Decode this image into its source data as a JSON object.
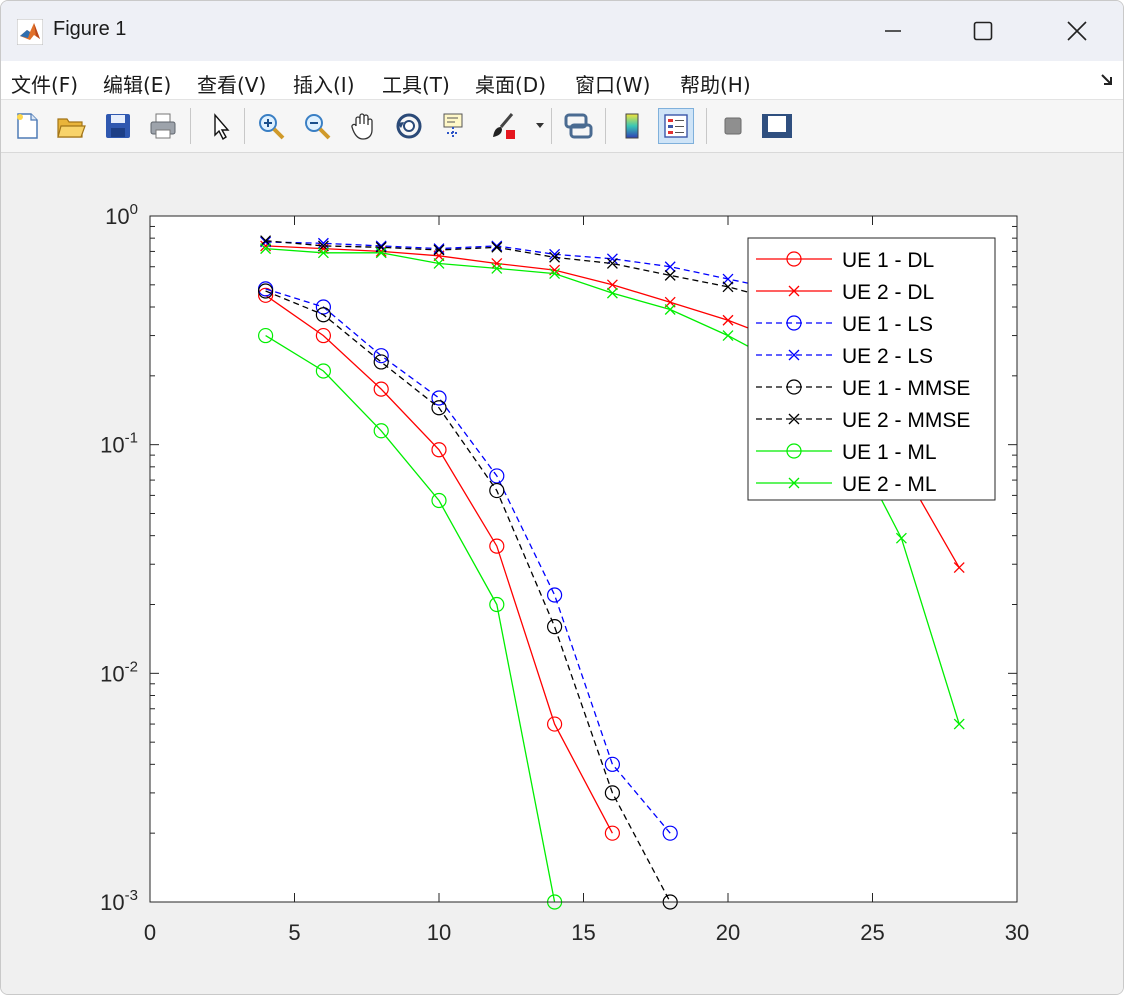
{
  "window": {
    "title": "Figure 1"
  },
  "menu": [
    {
      "label": "文件(F)",
      "key": "file"
    },
    {
      "label": "编辑(E)",
      "key": "edit"
    },
    {
      "label": "查看(V)",
      "key": "view"
    },
    {
      "label": "插入(I)",
      "key": "insert"
    },
    {
      "label": "工具(T)",
      "key": "tools"
    },
    {
      "label": "桌面(D)",
      "key": "desktop"
    },
    {
      "label": "窗口(W)",
      "key": "window"
    },
    {
      "label": "帮助(H)",
      "key": "help"
    }
  ],
  "toolbar": [
    {
      "icon": "new-figure-icon"
    },
    {
      "icon": "open-file-icon"
    },
    {
      "icon": "save-icon"
    },
    {
      "icon": "print-icon"
    },
    {
      "icon": "pointer-icon"
    },
    {
      "icon": "zoom-in-icon"
    },
    {
      "icon": "zoom-out-icon"
    },
    {
      "icon": "pan-hand-icon"
    },
    {
      "icon": "rotate-3d-icon"
    },
    {
      "icon": "data-cursor-icon"
    },
    {
      "icon": "brush-icon"
    },
    {
      "icon": "link-plot-icon"
    },
    {
      "icon": "colorbar-icon"
    },
    {
      "icon": "legend-icon",
      "active": true
    },
    {
      "icon": "hide-plot-tools-icon"
    },
    {
      "icon": "show-plot-tools-icon"
    }
  ],
  "colors": {
    "red": "#ff0000",
    "blue": "#0000ff",
    "black": "#000000",
    "green": "#00ee00"
  },
  "chart_data": {
    "type": "line",
    "title": "",
    "xlabel": "",
    "ylabel": "",
    "xlim": [
      0,
      30
    ],
    "ylim": [
      0.001,
      1
    ],
    "yscale": "log",
    "xticks": [
      0,
      5,
      10,
      15,
      20,
      25,
      30
    ],
    "xtick_labels": [
      "0",
      "5",
      "10",
      "15",
      "20",
      "25",
      "30"
    ],
    "yticks": [
      {
        "value": 1,
        "base": "10",
        "exp": "0"
      },
      {
        "value": 0.1,
        "base": "10",
        "exp": "-1"
      },
      {
        "value": 0.01,
        "base": "10",
        "exp": "-2"
      },
      {
        "value": 0.001,
        "base": "10",
        "exp": "-3"
      }
    ],
    "grid": false,
    "legend_position": "top-right",
    "series": [
      {
        "name": "UE 1 - DL",
        "color": "#ff0000",
        "dash": "solid",
        "marker": "o",
        "x": [
          4,
          6,
          8,
          10,
          12,
          14,
          16
        ],
        "y": [
          0.45,
          0.3,
          0.175,
          0.095,
          0.036,
          0.006,
          0.002
        ]
      },
      {
        "name": "UE 2 - DL",
        "color": "#ff0000",
        "dash": "solid",
        "marker": "x",
        "x": [
          4,
          6,
          8,
          10,
          12,
          14,
          16,
          18,
          20,
          22,
          24,
          26,
          28
        ],
        "y": [
          0.74,
          0.72,
          0.7,
          0.67,
          0.62,
          0.58,
          0.5,
          0.42,
          0.35,
          0.28,
          0.18,
          0.08,
          0.029
        ]
      },
      {
        "name": "UE 1 - LS",
        "color": "#0000ff",
        "dash": "dashed",
        "marker": "o",
        "x": [
          4,
          6,
          8,
          10,
          12,
          14,
          16,
          18
        ],
        "y": [
          0.48,
          0.4,
          0.245,
          0.16,
          0.073,
          0.022,
          0.004,
          0.002
        ]
      },
      {
        "name": "UE 2 - LS",
        "color": "#0000ff",
        "dash": "dashed",
        "marker": "x",
        "x": [
          4,
          6,
          8,
          10,
          12,
          14,
          16,
          18,
          20,
          22
        ],
        "y": [
          0.77,
          0.76,
          0.74,
          0.72,
          0.74,
          0.68,
          0.65,
          0.6,
          0.53,
          0.47
        ]
      },
      {
        "name": "UE 1 - MMSE",
        "color": "#000000",
        "dash": "dashed",
        "marker": "o",
        "x": [
          4,
          6,
          8,
          10,
          12,
          14,
          16,
          18
        ],
        "y": [
          0.47,
          0.37,
          0.23,
          0.145,
          0.063,
          0.016,
          0.003,
          0.001
        ]
      },
      {
        "name": "UE 2 - MMSE",
        "color": "#000000",
        "dash": "dashed",
        "marker": "x",
        "x": [
          4,
          6,
          8,
          10,
          12,
          14,
          16,
          18,
          20,
          22
        ],
        "y": [
          0.78,
          0.74,
          0.73,
          0.71,
          0.73,
          0.66,
          0.62,
          0.55,
          0.49,
          0.42
        ]
      },
      {
        "name": "UE 1 - ML",
        "color": "#00ee00",
        "dash": "solid",
        "marker": "o",
        "x": [
          4,
          6,
          8,
          10,
          12,
          14
        ],
        "y": [
          0.3,
          0.21,
          0.115,
          0.057,
          0.02,
          0.001
        ]
      },
      {
        "name": "UE 2 - ML",
        "color": "#00ee00",
        "dash": "solid",
        "marker": "x",
        "x": [
          4,
          6,
          8,
          10,
          12,
          14,
          16,
          18,
          20,
          22,
          24,
          26,
          28
        ],
        "y": [
          0.72,
          0.69,
          0.69,
          0.62,
          0.59,
          0.56,
          0.46,
          0.39,
          0.3,
          0.22,
          0.12,
          0.039,
          0.006
        ]
      }
    ]
  }
}
